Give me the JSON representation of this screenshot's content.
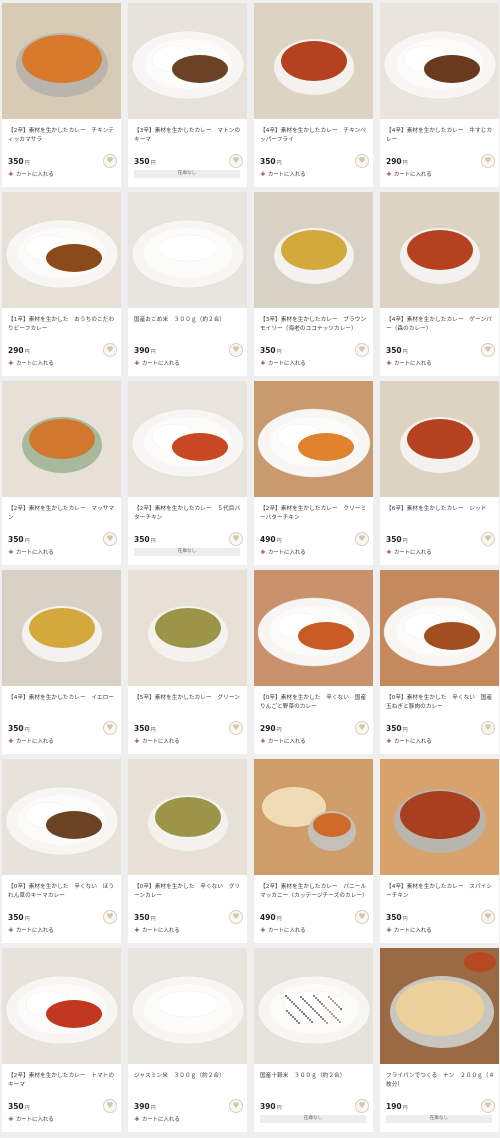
{
  "currency_unit": "円",
  "add_to_cart_label": "カートに入れる",
  "out_of_stock_label": "在庫なし",
  "products": [
    {
      "title": "【2辛】素材を生かしたカレー　チキンティッカマサラ",
      "price": "350",
      "status": "cart",
      "img": "bowl-orange"
    },
    {
      "title": "【3辛】素材を生かしたカレー　マトンのキーマ",
      "price": "350",
      "status": "soldout",
      "img": "plate-keema"
    },
    {
      "title": "【4辛】素材を生かしたカレー　チキンペッパーフライ",
      "price": "350",
      "status": "cart",
      "img": "bowl-red"
    },
    {
      "title": "【4辛】素材を生かしたカレー　牛すじカレー",
      "price": "290",
      "status": "cart",
      "img": "plate-brown"
    },
    {
      "title": "【1辛】素材を生かした　おうちのこだわりビーフカレー",
      "price": "290",
      "status": "cart",
      "img": "plate-beef"
    },
    {
      "title": "国産おこめ米　３００ｇ（約２合）",
      "price": "390",
      "status": "cart",
      "img": "plate-rice"
    },
    {
      "title": "【3辛】素材を生かしたカレー　ブラウンモイリー（海老のココナッツカレー）",
      "price": "350",
      "status": "cart",
      "img": "bowl-yellow"
    },
    {
      "title": "【4辛】素材を生かしたカレー　ゲーンパー（森のカレー）",
      "price": "350",
      "status": "cart",
      "img": "bowl-red"
    },
    {
      "title": "【2辛】素材を生かしたカレー　マッサマン",
      "price": "350",
      "status": "cart",
      "img": "bowl-green-orange"
    },
    {
      "title": "【2辛】素材を生かしたカレー　５代目バターチキン",
      "price": "350",
      "status": "soldout",
      "img": "plate-butter"
    },
    {
      "title": "【2辛】素材を生かしたカレー　クリーミーバターチキン",
      "price": "490",
      "status": "cart",
      "img": "plate-creamy"
    },
    {
      "title": "【6辛】素材を生かしたカレー　レッド",
      "price": "350",
      "status": "cart",
      "img": "bowl-red"
    },
    {
      "title": "【4辛】素材を生かしたカレー　イエロー",
      "price": "350",
      "status": "cart",
      "img": "bowl-yellow"
    },
    {
      "title": "【5辛】素材を生かしたカレー　グリーン",
      "price": "350",
      "status": "cart",
      "img": "bowl-green"
    },
    {
      "title": "【0辛】素材を生かした　辛くない　国産りんごと野菜のカレー",
      "price": "290",
      "status": "cart",
      "img": "plate-veg"
    },
    {
      "title": "【0辛】素材を生かした　辛くない　国産玉ねぎと豚肉のカレー",
      "price": "350",
      "status": "cart",
      "img": "plate-pork"
    },
    {
      "title": "【0辛】素材を生かした　辛くない　ほうれん草のキーマカレー",
      "price": "350",
      "status": "cart",
      "img": "plate-keema"
    },
    {
      "title": "【0辛】素材を生かした　辛くない　グリーンカレー",
      "price": "350",
      "status": "cart",
      "img": "bowl-green"
    },
    {
      "title": "【2辛】素材を生かしたカレー　パニールマッカニー（カッテージチーズのカレー）",
      "price": "490",
      "status": "cart",
      "img": "naan-bowl"
    },
    {
      "title": "【4辛】素材を生かしたカレー　スパイシーチキン",
      "price": "350",
      "status": "cart",
      "img": "steel-bowl"
    },
    {
      "title": "【2辛】素材を生かしたカレー　トマトのキーマ",
      "price": "350",
      "status": "cart",
      "img": "plate-tomato"
    },
    {
      "title": "ジャスミン米　３００ｇ（約２合）",
      "price": "390",
      "status": "cart",
      "img": "plate-rice"
    },
    {
      "title": "国産十穀米　３００ｇ（約２合）",
      "price": "390",
      "status": "soldout",
      "img": "plate-grain"
    },
    {
      "title": "フライパンでつくる　ナン　２００ｇ（４枚分）",
      "price": "190",
      "status": "soldout",
      "img": "naan"
    }
  ]
}
